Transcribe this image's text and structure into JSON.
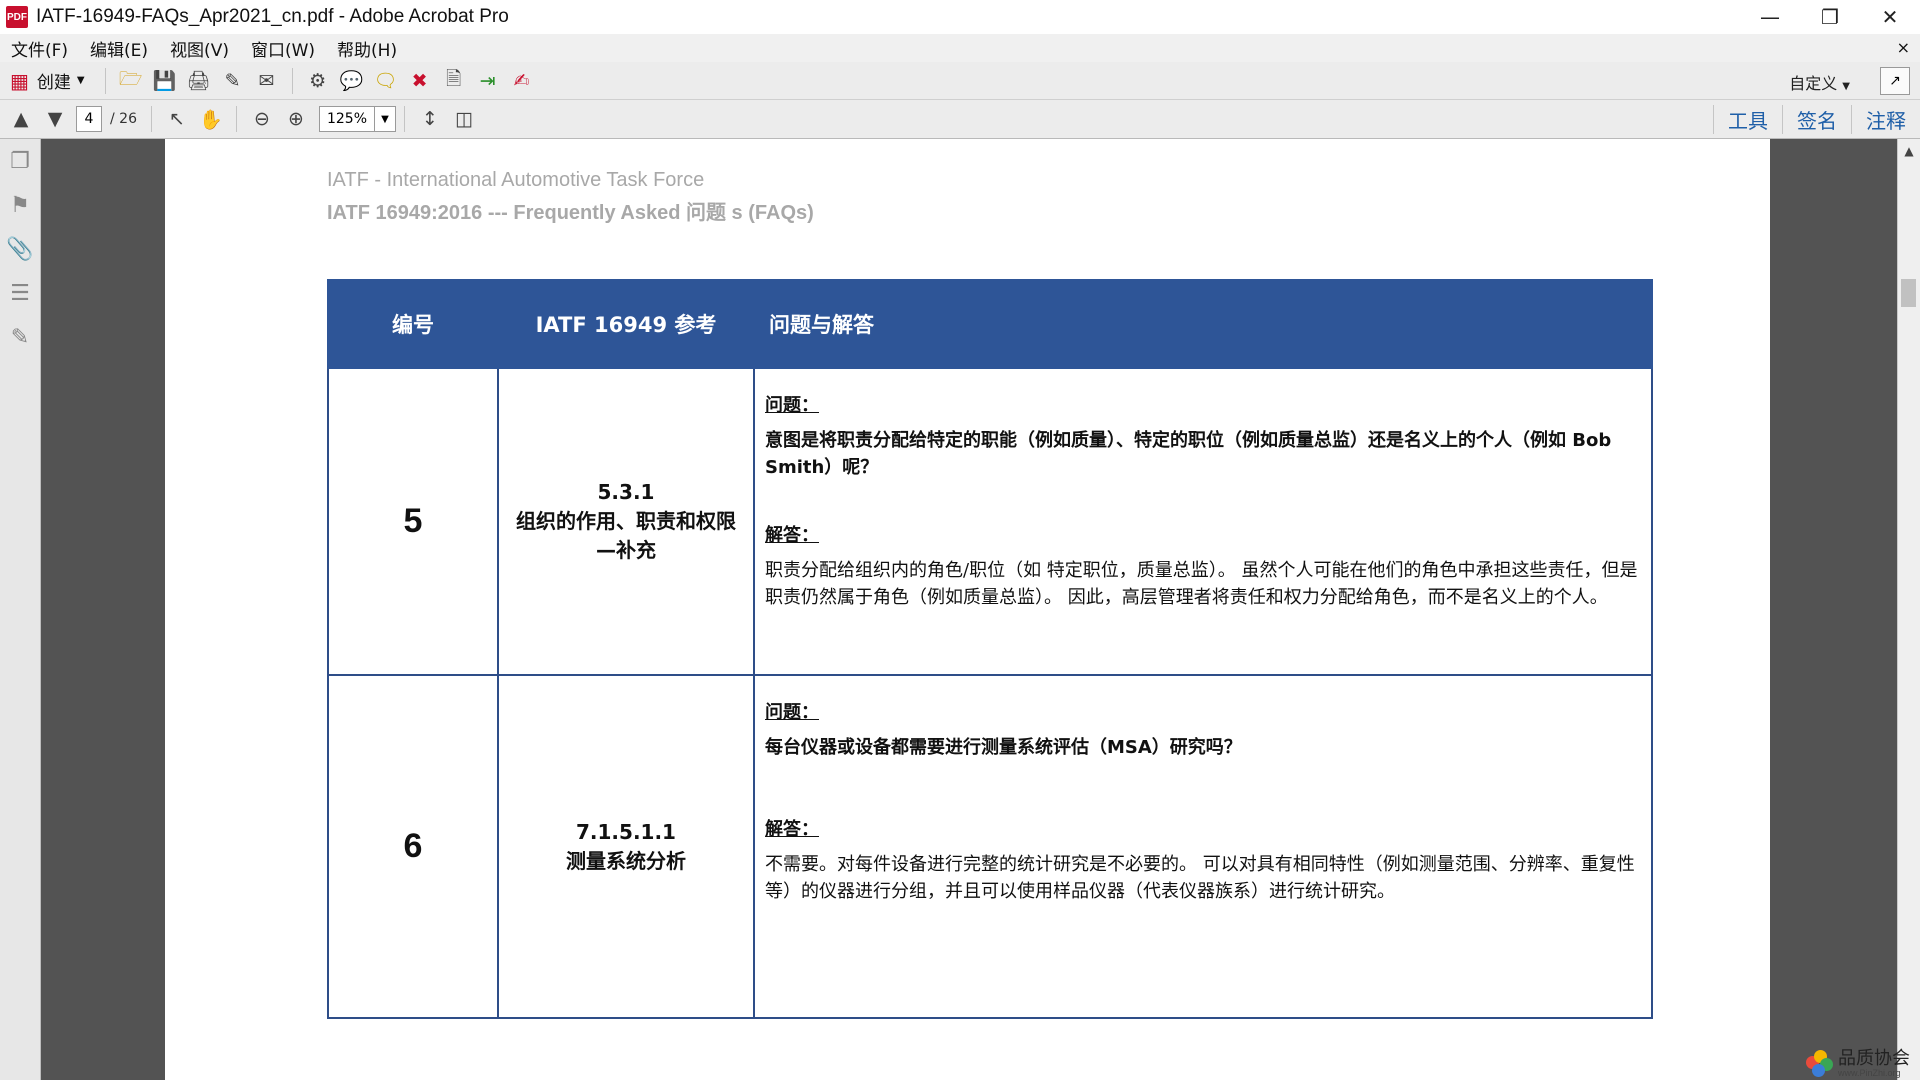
{
  "window": {
    "title": "IATF-16949-FAQs_Apr2021_cn.pdf - Adobe Acrobat Pro",
    "app_icon": "PDF"
  },
  "menu": {
    "items": [
      "文件(F)",
      "编辑(E)",
      "视图(V)",
      "窗口(W)",
      "帮助(H)"
    ],
    "close": "×"
  },
  "toolbar": {
    "create_label": "创建",
    "custom_label": "自定义"
  },
  "navigation": {
    "current_page": "4",
    "total_pages": "/ 26",
    "zoom": "125%"
  },
  "panel_tabs": [
    "工具",
    "签名",
    "注释"
  ],
  "document": {
    "header_line1": "IATF - International Automotive Task Force",
    "header_line2": "IATF 16949:2016 --- Frequently Asked 问题 s (FAQs)",
    "table": {
      "headers": [
        "编号",
        "IATF 16949 参考",
        "问题与解答"
      ],
      "rows": [
        {
          "number": "5",
          "ref_code": "5.3.1",
          "ref_title": "组织的作用、职责和权限—补充",
          "question_label": "问题：",
          "question": "意图是将职责分配给特定的职能（例如质量）、特定的职位（例如质量总监）还是名义上的个人（例如 Bob Smith）呢？",
          "answer_label": "解答：",
          "answer": "职责分配给组织内的角色/职位（如 特定职位，质量总监）。 虽然个人可能在他们的角色中承担这些责任，但是职责仍然属于角色（例如质量总监）。 因此，高层管理者将责任和权力分配给角色，而不是名义上的个人。"
        },
        {
          "number": "6",
          "ref_code": "7.1.5.1.1",
          "ref_title": "测量系统分析",
          "question_label": "问题：",
          "question": "每台仪器或设备都需要进行测量系统评估（MSA）研究吗？",
          "answer_label": "解答：",
          "answer": "不需要。对每件设备进行完整的统计研究是不必要的。 可以对具有相同特性（例如测量范围、分辨率、重复性等）的仪器进行分组，并且可以使用样品仪器（代表仪器族系）进行统计研究。"
        }
      ]
    }
  },
  "watermark": {
    "text": "品质协会",
    "url": "www.PinZhi.org"
  },
  "colors": {
    "table_header": "#2e5597",
    "panel_tab_text": "#1f5fa8"
  }
}
